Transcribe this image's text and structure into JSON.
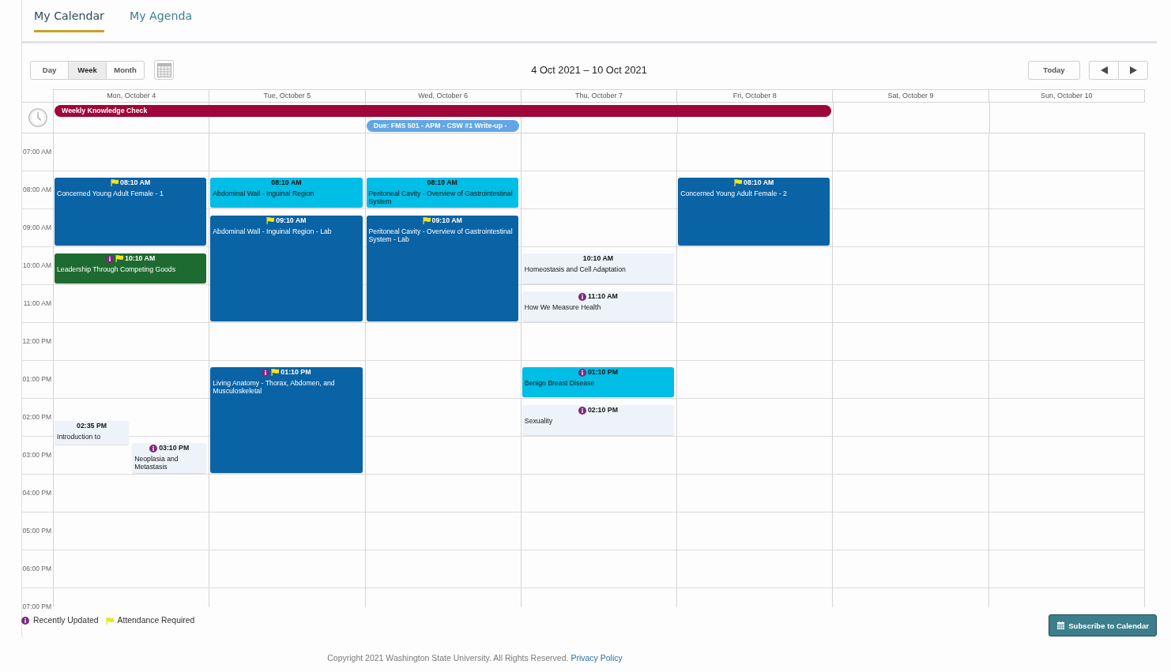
{
  "tabs": [
    {
      "label": "My Calendar",
      "selected": true
    },
    {
      "label": "My Agenda",
      "selected": false
    }
  ],
  "toolbar": {
    "view_buttons": [
      {
        "label": "Day",
        "selected": false
      },
      {
        "label": "Week",
        "selected": true
      },
      {
        "label": "Month",
        "selected": false
      }
    ],
    "date_range": "4 Oct 2021 – 10 Oct 2021",
    "today_button": "Today"
  },
  "calendar": {
    "days": [
      {
        "label": "Mon, October 4",
        "all_day_events": [
          {
            "title": "Weekly Knowledge Check",
            "color": "#a00637"
          }
        ],
        "events": [
          {
            "time": "08:10 AM",
            "title": "Concerned Young Adult Female - 1",
            "color": "#0a63a5",
            "attendance_required": true,
            "recently_updated": false
          },
          {
            "time": "10:10 AM",
            "title": "Leadership Through Competing Goods",
            "color": "#1d6b30",
            "attendance_required": true,
            "recently_updated": true
          },
          {
            "time": "02:35 PM",
            "title": "Introduction to",
            "color": "#eef3fa",
            "attendance_required": false,
            "recently_updated": false
          },
          {
            "time": "03:10 PM",
            "title": "Neoplasia and Metastasis",
            "color": "#eef3fa",
            "attendance_required": false,
            "recently_updated": true
          }
        ]
      },
      {
        "label": "Tue, October 5",
        "events": [
          {
            "time": "08:10 AM",
            "title": "Abdominal Wall - Inguinal Region",
            "color": "#00bee6",
            "attendance_required": false,
            "recently_updated": false
          },
          {
            "time": "09:10 AM",
            "title": "Abdominal Wall - Inguinal Region - Lab",
            "color": "#0a63a5",
            "attendance_required": true,
            "recently_updated": false
          },
          {
            "time": "01:10 PM",
            "title": "Living Anatomy - Thorax, Abdomen, and Musculoskeletal",
            "color": "#0a63a5",
            "attendance_required": true,
            "recently_updated": true
          }
        ]
      },
      {
        "label": "Wed, October 6",
        "all_day_events": [
          {
            "title": "Due: FMS 501 - APM - CSW #1 Write-up -",
            "color": "#62a6e6"
          }
        ],
        "events": [
          {
            "time": "08:10 AM",
            "title": "Peritoneal Cavity - Overview of Gastrointestinal System",
            "color": "#00bee6",
            "attendance_required": false,
            "recently_updated": false
          },
          {
            "time": "09:10 AM",
            "title": "Peritoneal Cavity - Overview of Gastrointestinal System - Lab",
            "color": "#0a63a5",
            "attendance_required": true,
            "recently_updated": false
          }
        ]
      },
      {
        "label": "Thu, October 7",
        "events": [
          {
            "time": "10:10 AM",
            "title": "Homeostasis and Cell Adaptation",
            "color": "#eef3fa",
            "attendance_required": false,
            "recently_updated": false
          },
          {
            "time": "11:10 AM",
            "title": "How We Measure Health",
            "color": "#eef3fa",
            "attendance_required": false,
            "recently_updated": true
          },
          {
            "time": "01:10 PM",
            "title": "Benign Breast Disease",
            "color": "#00bee6",
            "attendance_required": false,
            "recently_updated": true
          },
          {
            "time": "02:10 PM",
            "title": "Sexuality",
            "color": "#eef3fa",
            "attendance_required": false,
            "recently_updated": true
          }
        ]
      },
      {
        "label": "Fri, October 8",
        "events": [
          {
            "time": "08:10 AM",
            "title": "Concerned Young Adult Female - 2",
            "color": "#0a63a5",
            "attendance_required": true,
            "recently_updated": false
          }
        ]
      },
      {
        "label": "Sat, October 9"
      },
      {
        "label": "Sun, October 10"
      }
    ],
    "hours": [
      "07:00 AM",
      "08:00 AM",
      "09:00 AM",
      "10:00 AM",
      "11:00 AM",
      "12:00 PM",
      "01:00 PM",
      "02:00 PM",
      "03:00 PM",
      "04:00 PM",
      "05:00 PM",
      "06:00 PM",
      "07:00 PM"
    ]
  },
  "legend": [
    {
      "kind": "updated",
      "label": "Recently Updated"
    },
    {
      "kind": "attendance",
      "label": "Attendance Required"
    }
  ],
  "subscribe_button": "Subscribe to Calendar",
  "footer": {
    "text": "Copyright 2021 Washington State University. All Rights Reserved.",
    "link": "Privacy Policy"
  }
}
